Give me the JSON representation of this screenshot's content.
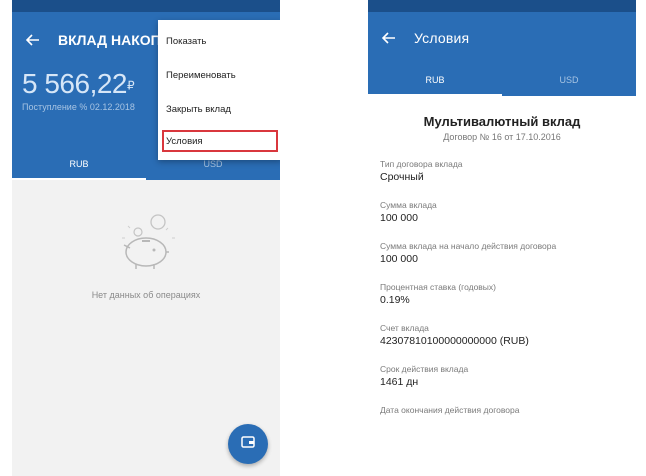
{
  "left": {
    "title": "ВКЛАД НАКОП",
    "balance": "5 566,22",
    "currency_symbol": "₽",
    "accrual_text": "Поступление % 02.12.2018",
    "tabs": [
      {
        "label": "RUB"
      },
      {
        "label": "USD"
      }
    ],
    "empty_text": "Нет данных об операциях",
    "menu": {
      "items": [
        {
          "label": "Показать"
        },
        {
          "label": "Переименовать"
        },
        {
          "label": "Закрыть вклад"
        },
        {
          "label": "Условия"
        }
      ]
    }
  },
  "right": {
    "title": "Условия",
    "tabs": [
      {
        "label": "RUB"
      },
      {
        "label": "USD"
      }
    ],
    "deposit_title": "Мультивалютный вклад",
    "contract": "Договор № 16 от 17.10.2016",
    "fields": [
      {
        "label": "Тип договора вклада",
        "value": "Срочный"
      },
      {
        "label": "Сумма вклада",
        "value": "100 000"
      },
      {
        "label": "Сумма вклада на начало действия договора",
        "value": "100 000"
      },
      {
        "label": "Процентная ставка (годовых)",
        "value": "0.19%"
      },
      {
        "label": "Счет вклада",
        "value": "42307810100000000000 (RUB)"
      },
      {
        "label": "Срок действия вклада",
        "value": "1461 дн"
      },
      {
        "label": "Дата окончания действия договора",
        "value": ""
      }
    ]
  },
  "colors": {
    "primary": "#2a6db5",
    "statusbar": "#1b4f8a",
    "highlight": "#d9373d"
  },
  "icons": {
    "back": "arrow-left-icon",
    "fab": "wallet-icon",
    "empty": "piggy-bank-icon"
  }
}
